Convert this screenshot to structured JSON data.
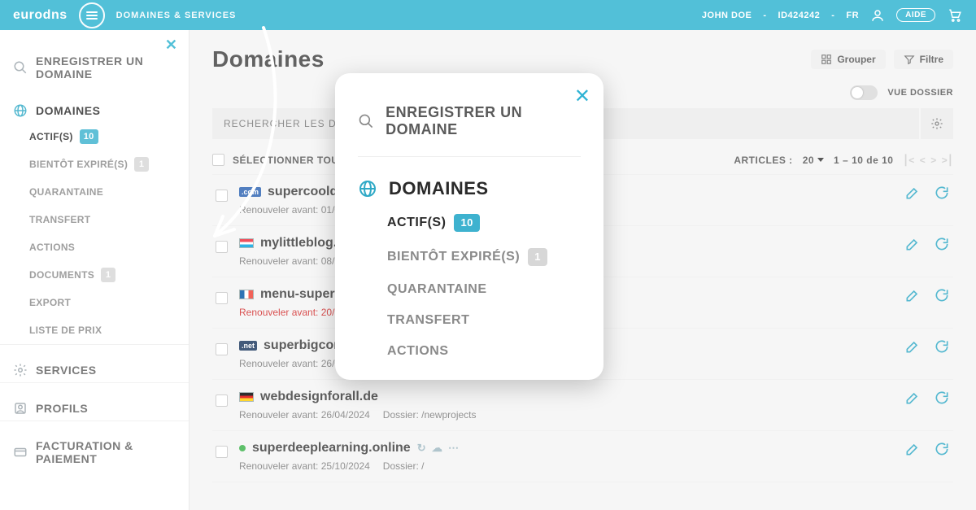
{
  "header": {
    "brand": "eurodns",
    "breadcrumb": "DOMAINES & SERVICES",
    "user": "JOHN DOE",
    "user_id": "ID424242",
    "lang": "FR",
    "aide": "AIDE"
  },
  "sidebar": {
    "close": "×",
    "register": "ENREGISTRER UN DOMAINE",
    "domaines": "DOMAINES",
    "subs": {
      "actifs": "ACTIF(S)",
      "actifs_n": "10",
      "bientot": "BIENTÔT EXPIRÉ(S)",
      "bientot_n": "1",
      "quarantaine": "QUARANTAINE",
      "transfert": "TRANSFERT",
      "actions": "ACTIONS",
      "documents": "DOCUMENTS",
      "documents_n": "1",
      "export": "EXPORT",
      "liste_prix": "LISTE DE PRIX"
    },
    "services": "SERVICES",
    "profils": "PROFILS",
    "facturation": "FACTURATION & PAIEMENT"
  },
  "main": {
    "title": "Domaines",
    "grouper": "Grouper",
    "filtre": "Filtre",
    "vue_dossier": "VUE DOSSIER",
    "search_placeholder": "RECHERCHER LES DOMAINES",
    "select_all": "SÉLECTIONNER TOUT",
    "articles_label": "ARTICLES :",
    "articles_n": "20",
    "pager_range": "1 – 10 de 10"
  },
  "rows": [
    {
      "name": "supercooldomain.com",
      "chip": ".com",
      "chip_class": "com",
      "renew": "Renouveler avant: 01/04/2023",
      "dossier": ""
    },
    {
      "name": "mylittleblog.lu",
      "flag": "lu",
      "renew": "Renouveler avant: 08/10/2023",
      "dossier": ""
    },
    {
      "name": "menu-super-restaurant.fr",
      "flag": "fr",
      "renew": "Renouveler avant: 20/12/2022",
      "red": true,
      "dossier": ""
    },
    {
      "name": "superbigcorporate.net",
      "chip": ".net",
      "chip_class": "net",
      "renew": "Renouveler avant: 26/01/2024",
      "dossier": ""
    },
    {
      "name": "webdesignforall.de",
      "flag": "de",
      "renew": "Renouveler avant: 26/04/2024",
      "dossier": "Dossier: /newprojects"
    },
    {
      "name": "superdeeplearning.online",
      "dot": true,
      "renew": "Renouveler avant: 25/10/2024",
      "dossier": "Dossier: /"
    }
  ],
  "popout": {
    "register": "ENREGISTRER UN DOMAINE",
    "domaines": "DOMAINES",
    "actifs": "ACTIF(S)",
    "actifs_n": "10",
    "bientot": "BIENTÔT EXPIRÉ(S)",
    "bientot_n": "1",
    "quarantaine": "QUARANTAINE",
    "transfert": "TRANSFERT",
    "actions": "ACTIONS"
  }
}
